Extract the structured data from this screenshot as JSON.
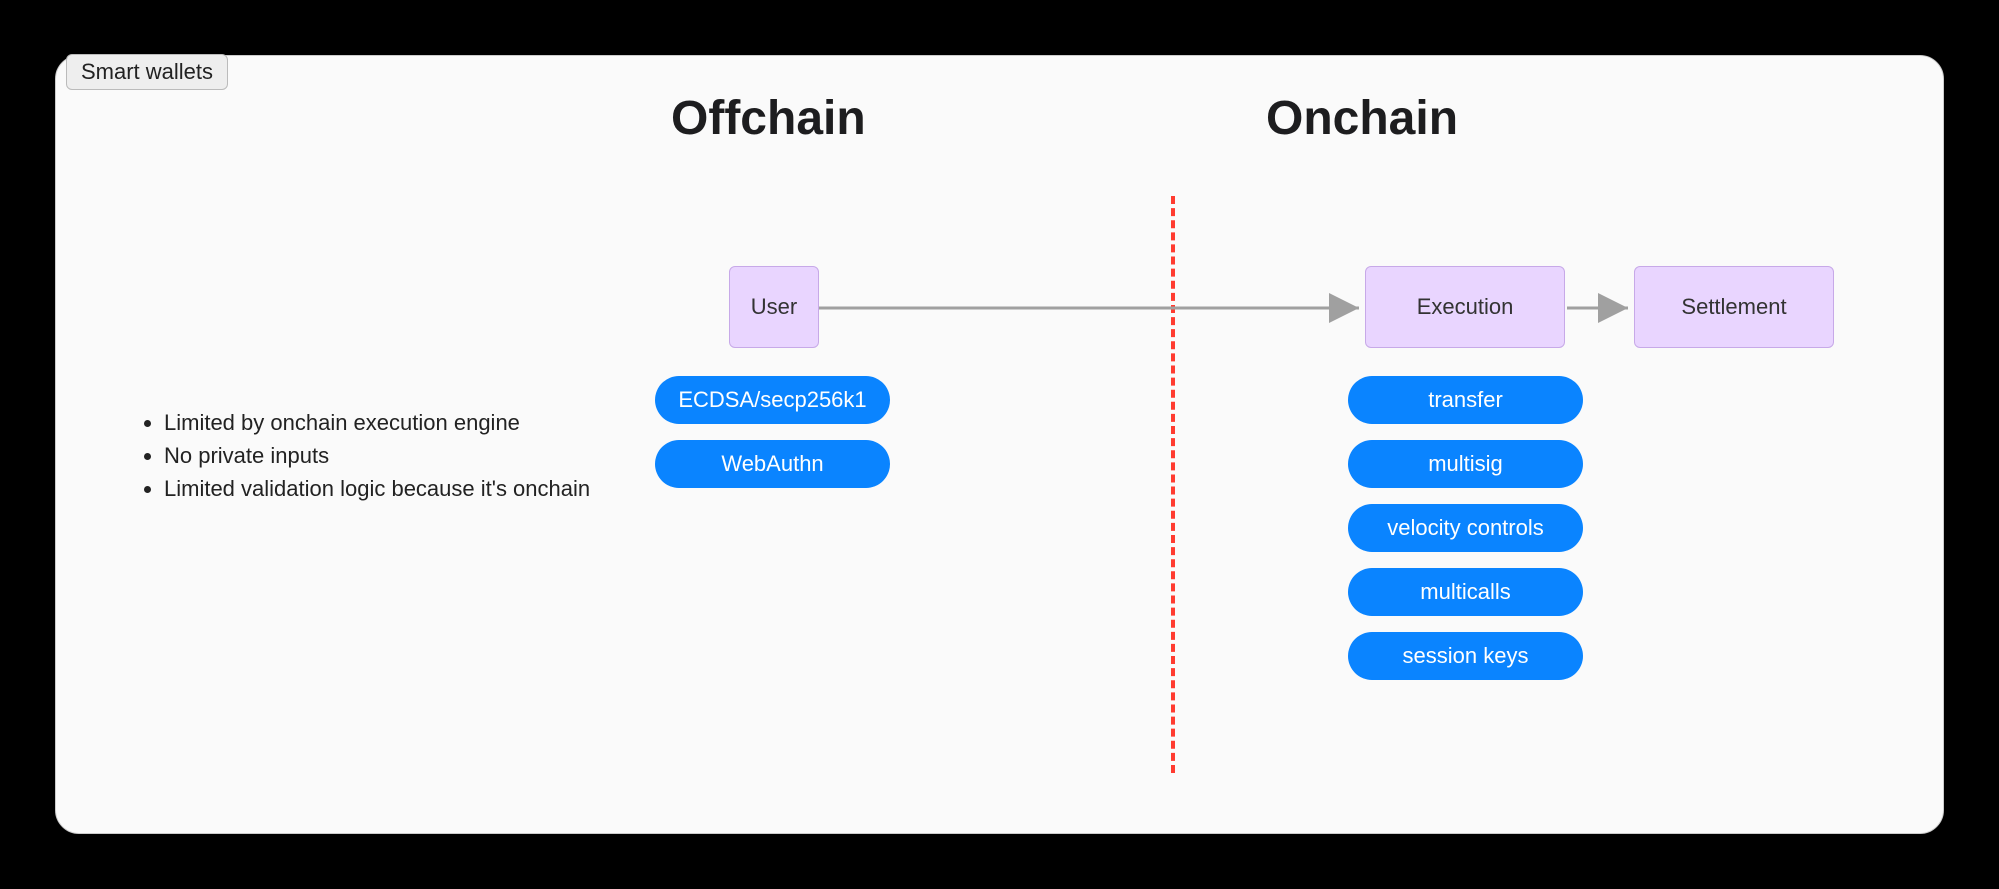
{
  "tab_label": "Smart wallets",
  "headings": {
    "offchain": "Offchain",
    "onchain": "Onchain"
  },
  "bullets": [
    "Limited by onchain execution engine",
    "No private inputs",
    "Limited validation logic because it's onchain"
  ],
  "nodes": {
    "user": "User",
    "execution": "Execution",
    "settlement": "Settlement"
  },
  "user_pills": [
    "ECDSA/secp256k1",
    "WebAuthn"
  ],
  "exec_pills": [
    "transfer",
    "multisig",
    "velocity controls",
    "multicalls",
    "session keys"
  ],
  "colors": {
    "pill_bg": "#0a84ff",
    "node_bg": "#e9d5ff",
    "divider": "#ff3b30"
  }
}
